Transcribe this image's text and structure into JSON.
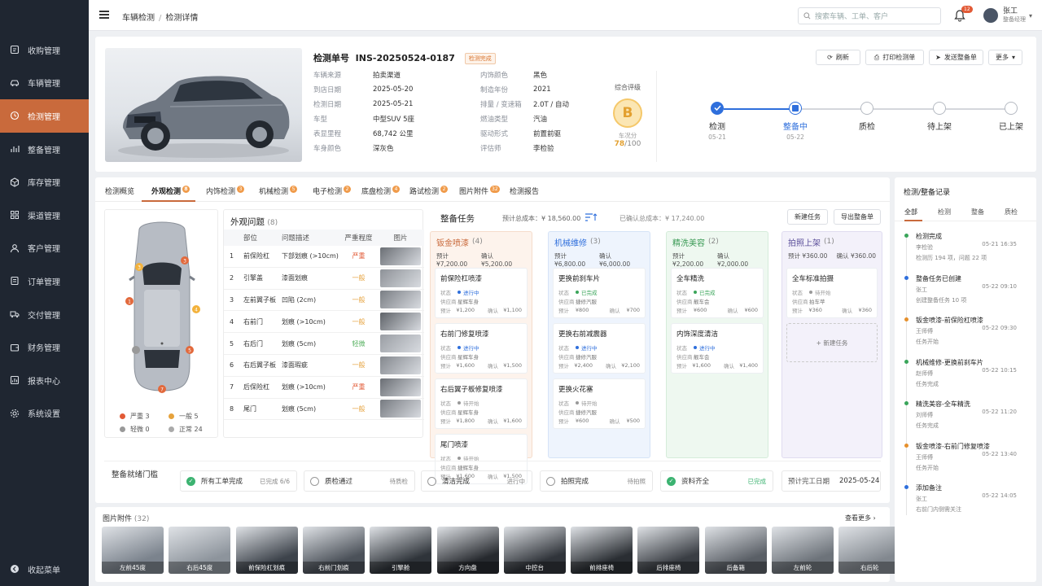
{
  "sidebar": {
    "items": [
      {
        "label": "收购管理",
        "icon": "bag-icon"
      },
      {
        "label": "车辆管理",
        "icon": "car-icon"
      },
      {
        "label": "检测管理",
        "icon": "inspect-icon",
        "active": true
      },
      {
        "label": "整备管理",
        "icon": "wrench-icon"
      },
      {
        "label": "库存管理",
        "icon": "box-icon"
      },
      {
        "label": "渠道管理",
        "icon": "grid-icon"
      },
      {
        "label": "客户管理",
        "icon": "user-icon"
      },
      {
        "label": "订单管理",
        "icon": "order-icon"
      },
      {
        "label": "交付管理",
        "icon": "truck-icon"
      },
      {
        "label": "财务管理",
        "icon": "wallet-icon"
      },
      {
        "label": "报表中心",
        "icon": "report-icon"
      },
      {
        "label": "系统设置",
        "icon": "gear-icon"
      }
    ],
    "collapse_label": "收起菜单"
  },
  "header": {
    "crumb1": "车辆检测",
    "crumb_sep": "/",
    "crumb2": "检测详情",
    "search_placeholder": "搜索车辆、工单、客户",
    "notif_count": "12",
    "user_name": "张工",
    "user_role": "整备经理"
  },
  "inspection": {
    "label": "检测单号",
    "number": "INS-20250524-0187",
    "status": "检测完成",
    "left_info": [
      {
        "k": "车辆来源",
        "v": "拍卖渠道"
      },
      {
        "k": "到店日期",
        "v": "2025-05-20"
      },
      {
        "k": "检测日期",
        "v": "2025-05-21"
      },
      {
        "k": "车型",
        "v": "中型SUV 5座"
      },
      {
        "k": "表显里程",
        "v": "68,742 公里"
      },
      {
        "k": "车身颜色",
        "v": "深灰色"
      }
    ],
    "right_info": [
      {
        "k": "内饰颜色",
        "v": "黑色"
      },
      {
        "k": "制造年份",
        "v": "2021"
      },
      {
        "k": "排量 / 变速箱",
        "v": "2.0T / 自动"
      },
      {
        "k": "燃油类型",
        "v": "汽油"
      },
      {
        "k": "驱动形式",
        "v": "前置前驱"
      },
      {
        "k": "评估师",
        "v": "李检验"
      }
    ],
    "rating_label": "综合评级",
    "grade": "B",
    "score_label": "车况分",
    "score": "78",
    "score_max": "/100"
  },
  "actions": {
    "refresh": "刷新",
    "print": "打印检测单",
    "send": "发送整备单",
    "more": "更多"
  },
  "steps": [
    {
      "label": "检测",
      "date": "05-21",
      "state": "done"
    },
    {
      "label": "整备中",
      "date": "05-22",
      "state": "current"
    },
    {
      "label": "质检",
      "date": "",
      "state": "todo"
    },
    {
      "label": "待上架",
      "date": "",
      "state": "todo"
    },
    {
      "label": "已上架",
      "date": "",
      "state": "todo"
    }
  ],
  "tabs": [
    {
      "label": "检测概览",
      "count": ""
    },
    {
      "label": "外观检测",
      "count": "8"
    },
    {
      "label": "内饰检测",
      "count": "3"
    },
    {
      "label": "机械检测",
      "count": "5"
    },
    {
      "label": "电子检测",
      "count": "2"
    },
    {
      "label": "底盘检测",
      "count": "4"
    },
    {
      "label": "路试检测",
      "count": "2"
    },
    {
      "label": "图片附件",
      "count": "32"
    },
    {
      "label": "检测报告",
      "count": ""
    }
  ],
  "damage_legend": {
    "severe": "严重 3",
    "normal": "一般 5",
    "minor": "轻微 0",
    "ok": "正常 24"
  },
  "issues": {
    "title": "外观问题",
    "count": "(8)",
    "headers": [
      "部位",
      "问题描述",
      "严重程度",
      "图片"
    ],
    "rows": [
      {
        "no": "1",
        "part": "前保险杠",
        "desc": "下部划痕 (>10cm)",
        "sev": "严重",
        "level": "h"
      },
      {
        "no": "2",
        "part": "引擎盖",
        "desc": "漆面划痕",
        "sev": "一般",
        "level": "m"
      },
      {
        "no": "3",
        "part": "左前翼子板",
        "desc": "凹陷 (2cm)",
        "sev": "一般",
        "level": "m"
      },
      {
        "no": "4",
        "part": "右前门",
        "desc": "划痕 (>10cm)",
        "sev": "一般",
        "level": "m"
      },
      {
        "no": "5",
        "part": "右后门",
        "desc": "划痕 (5cm)",
        "sev": "轻微",
        "level": "l"
      },
      {
        "no": "6",
        "part": "右后翼子板",
        "desc": "漆面瑕疵",
        "sev": "一般",
        "level": "m"
      },
      {
        "no": "7",
        "part": "后保险杠",
        "desc": "划痕 (>10cm)",
        "sev": "严重",
        "level": "h"
      },
      {
        "no": "8",
        "part": "尾门",
        "desc": "划痕 (5cm)",
        "sev": "一般",
        "level": "m"
      }
    ]
  },
  "tasks": {
    "title": "整备任务",
    "est_total": "预计总成本：¥ 18,560.00",
    "confirmed_total": "已确认总成本：¥ 17,240.00",
    "new_btn": "新建任务",
    "export_btn": "导出整备单",
    "labels": {
      "status": "状态",
      "vendor": "供应商",
      "est": "预计",
      "confirm": "确认",
      "add": "+ 新建任务"
    },
    "columns": [
      {
        "title": "钣金喷漆",
        "count": "(4)",
        "est": "预计 ¥7,200.00",
        "confirm": "确认 ¥5,200.00",
        "cards": [
          {
            "title": "前保险杠喷漆",
            "status": "进行中",
            "vendor": "星辉车身",
            "est": "¥1,200",
            "confirm": "¥1,100"
          },
          {
            "title": "右前门修复喷漆",
            "status": "进行中",
            "vendor": "星辉车身",
            "est": "¥1,600",
            "confirm": "¥1,500"
          },
          {
            "title": "右后翼子板修复喷漆",
            "status": "待开始",
            "vendor": "星辉车身",
            "est": "¥1,800",
            "confirm": "¥1,600"
          },
          {
            "title": "尾门喷漆",
            "status": "待开始",
            "vendor": "捷辉车身",
            "est": "¥1,600",
            "confirm": "¥1,500"
          }
        ]
      },
      {
        "title": "机械维修",
        "count": "(3)",
        "est": "预计 ¥6,800.00",
        "confirm": "确认 ¥6,000.00",
        "cards": [
          {
            "title": "更换前刹车片",
            "status": "已完成",
            "vendor": "捷修汽服",
            "est": "¥800",
            "confirm": "¥700"
          },
          {
            "title": "更换右前减震器",
            "status": "进行中",
            "vendor": "捷修汽服",
            "est": "¥2,400",
            "confirm": "¥2,100"
          },
          {
            "title": "更换火花塞",
            "status": "待开始",
            "vendor": "捷修汽服",
            "est": "¥600",
            "confirm": "¥500"
          }
        ]
      },
      {
        "title": "精洗美容",
        "count": "(2)",
        "est": "预计 ¥2,200.00",
        "confirm": "确认 ¥2,000.00",
        "cards": [
          {
            "title": "全车精洗",
            "status": "已完成",
            "vendor": "靓车会",
            "est": "¥600",
            "confirm": "¥600"
          },
          {
            "title": "内饰深度清洁",
            "status": "进行中",
            "vendor": "靓车会",
            "est": "¥1,600",
            "confirm": "¥1,400"
          }
        ]
      },
      {
        "title": "拍照上架",
        "count": "(1)",
        "est": "预计 ¥360.00",
        "confirm": "确认 ¥360.00",
        "cards": [
          {
            "title": "全车标准拍摄",
            "status": "待开始",
            "vendor": "拍车苹",
            "est": "¥360",
            "confirm": "¥360"
          }
        ]
      }
    ]
  },
  "gate": {
    "title": "整备就绪门槛",
    "items": [
      {
        "label": "所有工单完成",
        "state": "已完成 6/6",
        "checked": true
      },
      {
        "label": "质检通过",
        "state": "待质检",
        "checked": false
      },
      {
        "label": "清洁完成",
        "state": "进行中",
        "checked": false
      },
      {
        "label": "拍照完成",
        "state": "待拍照",
        "checked": false
      },
      {
        "label": "资料齐全",
        "state": "已完成",
        "checked": true
      }
    ],
    "date_label": "预计完工日期",
    "date": "2025-05-24"
  },
  "photos": {
    "title": "图片附件",
    "count": "(32)",
    "more": "查看更多 ›",
    "items": [
      "左前45度",
      "右后45度",
      "前保险杠划痕",
      "右前门划痕",
      "引擎舱",
      "方向盘",
      "中控台",
      "前排座椅",
      "后排座椅",
      "后备箱",
      "左前轮",
      "右后轮"
    ]
  },
  "records": {
    "title": "检测/整备记录",
    "tabs": [
      "全部",
      "检测",
      "整备",
      "质检"
    ],
    "items": [
      {
        "title": "检测完成",
        "who": "李检验",
        "time": "05-21 16:35",
        "desc": "检测历 194 项，问题 22 项",
        "color": "#3aa55a"
      },
      {
        "title": "整备任务已创建",
        "who": "张工",
        "time": "05-22 09:10",
        "desc": "创建整备任务 10 项",
        "color": "#2f6fdc"
      },
      {
        "title": "钣金喷漆-前保险杠喷漆",
        "who": "王师傅",
        "time": "05-22 09:30",
        "desc": "任务开始",
        "color": "#e6902c"
      },
      {
        "title": "机械维修-更换前刹车片",
        "who": "赵师傅",
        "time": "05-22 10:15",
        "desc": "任务完成",
        "color": "#3aa55a"
      },
      {
        "title": "精洗美容-全车精洗",
        "who": "刘师傅",
        "time": "05-22 11:20",
        "desc": "任务完成",
        "color": "#3aa55a"
      },
      {
        "title": "钣金喷漆-右前门修复喷漆",
        "who": "王师傅",
        "time": "05-22 13:40",
        "desc": "任务开始",
        "color": "#e6902c"
      },
      {
        "title": "添加备注",
        "who": "张工",
        "time": "05-22 14:05",
        "desc": "右前门内侧需关注",
        "color": "#2f6fdc"
      }
    ]
  },
  "colors": {
    "accent": "#c96a3c",
    "sidebar": "#1f2631",
    "primary": "#2f6fdc",
    "severe": "#e25a36",
    "normal": "#e6a23c",
    "minor": "#999999",
    "ok": "#3aa55a"
  }
}
